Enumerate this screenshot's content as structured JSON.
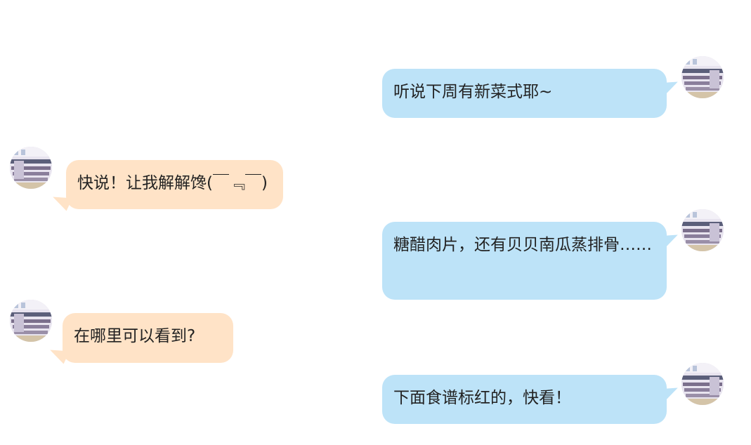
{
  "chat": {
    "messages": [
      {
        "side": "right",
        "text": "听说下周有新菜式耶~"
      },
      {
        "side": "left",
        "text": "快说！让我解解馋(￣﹃￣)"
      },
      {
        "side": "right",
        "text": "糖醋肉片，还有贝贝南瓜蒸排骨……"
      },
      {
        "side": "left",
        "text": "在哪里可以看到?"
      },
      {
        "side": "right",
        "text": "下面食谱标红的，快看！"
      }
    ]
  },
  "colors": {
    "right_bubble": "#bde3f8",
    "left_bubble": "#ffe3c7",
    "text": "#222222",
    "background": "#ffffff"
  },
  "icons": {
    "avatar": "classroom-avatar-icon"
  }
}
